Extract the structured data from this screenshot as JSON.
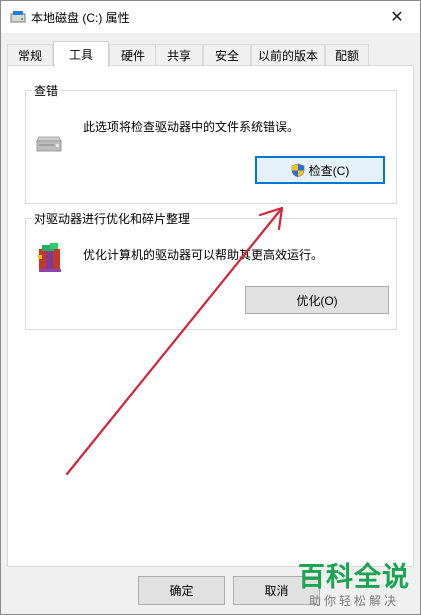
{
  "window": {
    "title": "本地磁盘 (C:) 属性",
    "close_label": "✕"
  },
  "tabs": [
    {
      "label": "常规",
      "active": false
    },
    {
      "label": "工具",
      "active": true
    },
    {
      "label": "硬件",
      "active": false
    },
    {
      "label": "共享",
      "active": false
    },
    {
      "label": "安全",
      "active": false
    },
    {
      "label": "以前的版本",
      "active": false
    },
    {
      "label": "配额",
      "active": false
    }
  ],
  "error_check": {
    "title": "查错",
    "description": "此选项将检查驱动器中的文件系统错误。",
    "button_label": "检查(C)",
    "icon": "drive-icon"
  },
  "optimize": {
    "title": "对驱动器进行优化和碎片整理",
    "description": "优化计算机的驱动器可以帮助其更高效运行。",
    "button_label": "优化(O)",
    "icon": "defrag-icon"
  },
  "dialog_buttons": {
    "ok_label": "确定",
    "cancel_label": "取消"
  },
  "watermark": {
    "main": "百科全说",
    "sub": "助你轻松解决"
  },
  "colors": {
    "annotation_arrow": "#d6243a",
    "focus_border": "#0078d7",
    "watermark_green": "#1aa551"
  }
}
